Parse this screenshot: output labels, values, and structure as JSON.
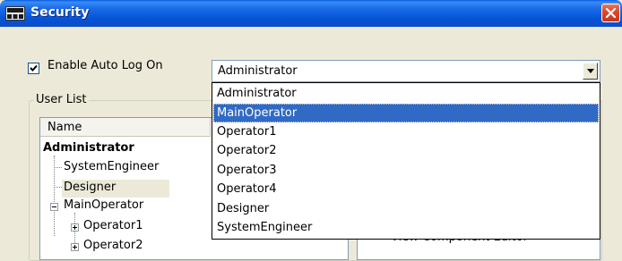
{
  "window": {
    "title": "Security",
    "close_label": "X"
  },
  "auto_logon": {
    "label": "Enable Auto Log On",
    "checked": true,
    "value": "Administrator"
  },
  "user_list": {
    "label": "User List",
    "column_header": "Name",
    "tree": [
      {
        "label": "Administrator",
        "bold": true
      },
      {
        "label": "SystemEngineer"
      },
      {
        "label": "Designer",
        "selected": true
      },
      {
        "label": "MainOperator",
        "expanded": true
      },
      {
        "label": "Operator1",
        "expanded": false
      },
      {
        "label": "Operator2",
        "expanded": false
      }
    ]
  },
  "right_panel": {
    "peek_text": "View Component Editor"
  },
  "dropdown": {
    "items": [
      "Administrator",
      "MainOperator",
      "Operator1",
      "Operator2",
      "Operator3",
      "Operator4",
      "Designer",
      "SystemEngineer"
    ],
    "highlighted_index": 1
  },
  "colors": {
    "titlebar": "#0b5ee0",
    "selection": "#316ac5",
    "window_bg": "#ece9d8"
  }
}
